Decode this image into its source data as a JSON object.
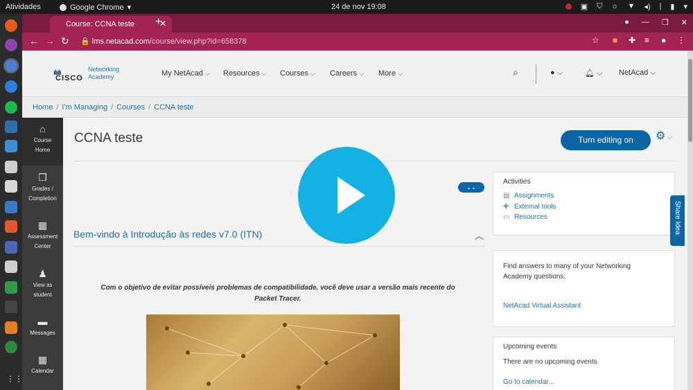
{
  "os_topbar": {
    "activities": "Atividades",
    "app": "Google Chrome",
    "clock": "24 de nov  19:08"
  },
  "browser": {
    "tab_title": "Course: CCNA teste",
    "url_host": "lms.netacad.com",
    "url_path": "/course/view.php?id=658378"
  },
  "site_nav": {
    "logo_word": "CISCO",
    "logo_sub": "Networking Academy",
    "menu": [
      "My NetAcad",
      "Resources",
      "Courses",
      "Careers",
      "More"
    ],
    "user": "NetAcad"
  },
  "breadcrumb": [
    "Home",
    "I'm Managing",
    "Courses",
    "CCNA teste"
  ],
  "left_nav": [
    {
      "label": "Course Home",
      "icon": "home-icon"
    },
    {
      "label": "Grades / Completion",
      "icon": "grades-icon"
    },
    {
      "label": "Assessment Center",
      "icon": "assessment-icon"
    },
    {
      "label": "View as student",
      "icon": "user-icon"
    },
    {
      "label": "Messages",
      "icon": "message-icon"
    },
    {
      "label": "Calendar",
      "icon": "calendar-icon"
    }
  ],
  "course": {
    "title": "CCNA teste",
    "edit_button": "Turn editing on",
    "section_title": "Bem-vindo à Introdução às redes v7.0 (ITN)",
    "note": "Com o objetivo de evitar possíveis problemas de compatibilidade, você deve usar a versão mais recente do Packet Tracer."
  },
  "sidebar": {
    "activities": {
      "heading": "Activities",
      "items": [
        "Assignments",
        "External tools",
        "Resources"
      ]
    },
    "assistant": {
      "text": "Find answers to many of your Networking Academy questions:",
      "link": "NetAcad Virtual Assistant"
    },
    "events": {
      "heading": "Upcoming events",
      "text": "There are no upcoming events",
      "link": "Go to calendar..."
    }
  },
  "share_tab": "Share Idea",
  "colors": {
    "accent": "#0c65a7",
    "chrome_frame": "#7b1a3f",
    "play_button": "#0ab0e3"
  }
}
